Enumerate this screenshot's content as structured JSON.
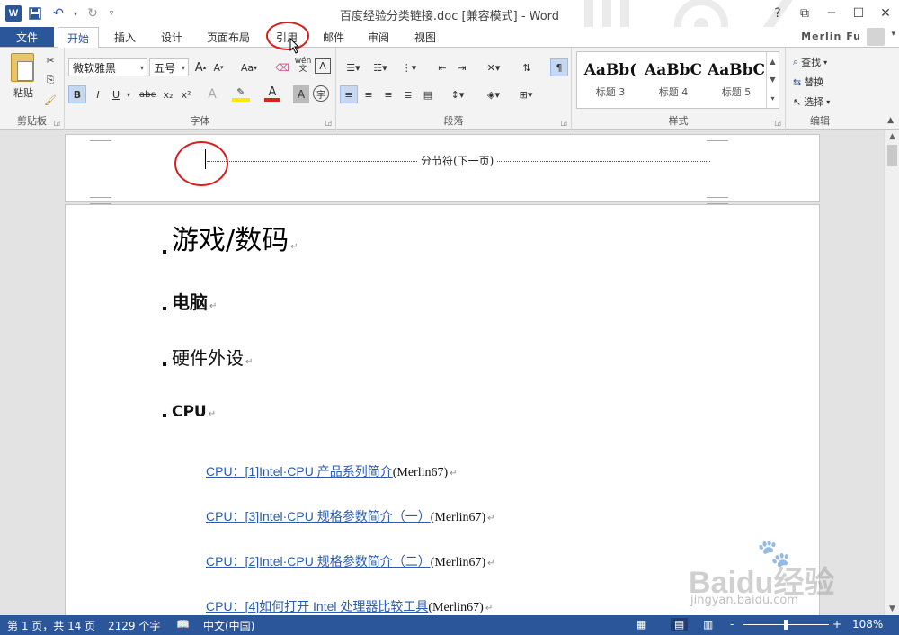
{
  "titlebar": {
    "title": "百度经验分类链接.doc [兼容模式] - Word",
    "help": "?"
  },
  "tabs": {
    "file": "文件",
    "items": [
      "开始",
      "插入",
      "设计",
      "页面布局",
      "引用",
      "邮件",
      "审阅",
      "视图"
    ],
    "active": "开始",
    "user": "Merlin Fu"
  },
  "ribbon": {
    "clipboard": {
      "label": "剪贴板",
      "paste": "粘贴"
    },
    "font": {
      "label": "字体",
      "font_name": "微软雅黑",
      "font_size": "五号",
      "wen": "wén",
      "char_a": "A",
      "char_aa": "Aa",
      "bold": "B",
      "italic": "I",
      "underline": "U",
      "strike": "abc",
      "sub": "x₂",
      "sup": "x²",
      "zi": "字"
    },
    "paragraph": {
      "label": "段落"
    },
    "styles": {
      "label": "样式",
      "items": [
        {
          "sample": "AaBb(",
          "name": "标题 3"
        },
        {
          "sample": "AaBbC",
          "name": "标题 4"
        },
        {
          "sample": "AaBbC",
          "name": "标题 5"
        }
      ]
    },
    "editing": {
      "label": "编辑",
      "find": "查找",
      "replace": "替换",
      "select": "选择"
    }
  },
  "document": {
    "section_break": "分节符(下一页)",
    "headings": [
      "游戏/数码",
      "电脑",
      "硬件外设",
      "CPU"
    ],
    "links": [
      {
        "text": "CPU：[1]Intel·CPU 产品系列简介",
        "author": "(Merlin67)"
      },
      {
        "text": "CPU：[3]Intel·CPU 规格参数简介（一）",
        "author": "(Merlin67)"
      },
      {
        "text": "CPU：[2]Intel·CPU 规格参数简介（二）",
        "author": "(Merlin67)"
      },
      {
        "text": "CPU：[4]如何打开 Intel 处理器比较工具",
        "author": "(Merlin67)"
      }
    ]
  },
  "statusbar": {
    "page": "第 1 页，共 14 页",
    "words": "2129 个字",
    "language": "中文(中国)",
    "zoom": "108%",
    "zoom_minus": "-",
    "zoom_plus": "+"
  },
  "watermark": {
    "brand": "Baidu经验",
    "domain": "jingyan.baidu.com"
  },
  "colors": {
    "accent": "#2b579a",
    "annotation": "#d81e1e",
    "link": "#2a5db0"
  }
}
